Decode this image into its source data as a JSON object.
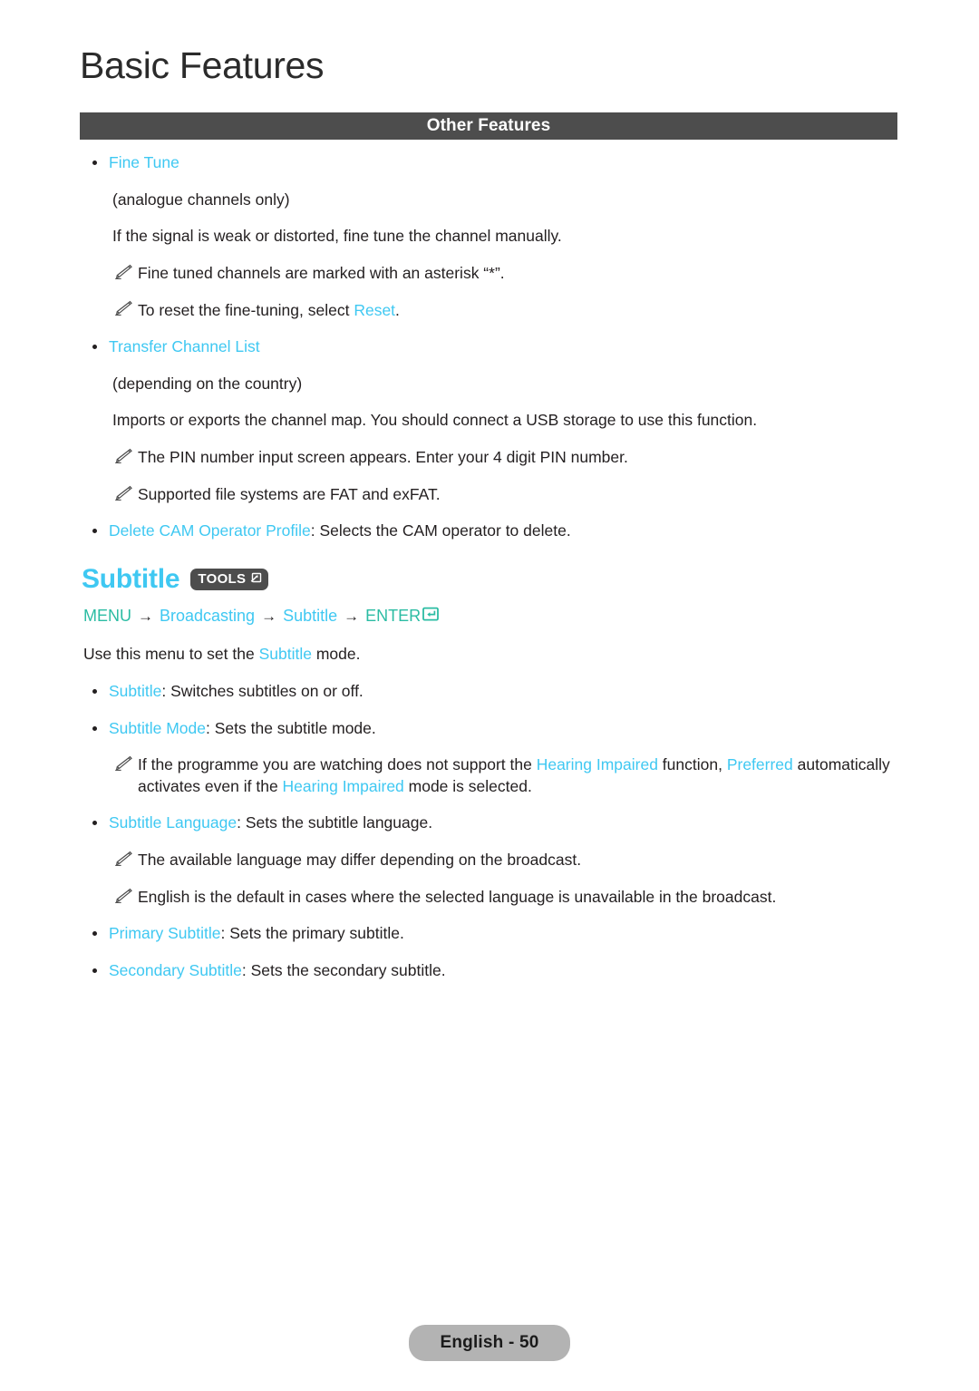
{
  "page": {
    "title": "Basic Features",
    "section_banner": "Other Features",
    "footer": "English - 50",
    "colors": {
      "highlight_blue": "#3fc8f2",
      "green": "#2bbca3",
      "banner_gray": "#4d4d4d",
      "footer_gray": "#b3b3b3",
      "body_text": "#231f20"
    }
  },
  "other_features": {
    "fine_tune": {
      "label": "Fine Tune",
      "note_paren": "(analogue channels only)",
      "description": "If the signal is weak or distorted, fine tune the channel manually.",
      "notes": [
        {
          "text_before": "Fine tuned channels are marked with an asterisk “*”.",
          "link": "",
          "text_after": ""
        },
        {
          "text_before": "To reset the fine-tuning, select ",
          "link": "Reset",
          "text_after": "."
        }
      ]
    },
    "transfer_channel_list": {
      "label": "Transfer Channel List",
      "note_paren": "(depending on the country)",
      "description": "Imports or exports the channel map. You should connect a USB storage to use this function.",
      "notes": [
        "The PIN number input screen appears. Enter your 4 digit PIN number.",
        "Supported file systems are FAT and exFAT."
      ]
    },
    "delete_cam": {
      "label": "Delete CAM Operator Profile",
      "description": ": Selects the CAM operator to delete."
    }
  },
  "subtitle_section": {
    "heading": "Subtitle",
    "tools_badge": "TOOLS",
    "breadcrumb": {
      "menu": "MENU",
      "arrow": "→",
      "broadcasting": "Broadcasting",
      "subtitle": "Subtitle",
      "enter": "ENTER"
    },
    "lead": {
      "before": "Use this menu to set the ",
      "link": "Subtitle",
      "after": " mode."
    },
    "items": [
      {
        "label": "Subtitle",
        "description": ": Switches subtitles on or off."
      },
      {
        "label": "Subtitle Mode",
        "description": ": Sets the subtitle mode."
      }
    ],
    "subtitle_mode_note": {
      "p1": "If the programme you are watching does not support the ",
      "l1": "Hearing Impaired",
      "p2": " function, ",
      "l2": "Preferred",
      "p3": " automatically activates even if the ",
      "l3": "Hearing Impaired",
      "p4": " mode is selected."
    },
    "subtitle_language": {
      "label": "Subtitle Language",
      "description": ": Sets the subtitle language.",
      "notes": [
        "The available language may differ depending on the broadcast.",
        "English is the default in cases where the selected language is unavailable in the broadcast."
      ]
    },
    "primary_subtitle": {
      "label": "Primary Subtitle",
      "description": ": Sets the primary subtitle."
    },
    "secondary_subtitle": {
      "label": "Secondary Subtitle",
      "description": ": Sets the secondary subtitle."
    }
  }
}
